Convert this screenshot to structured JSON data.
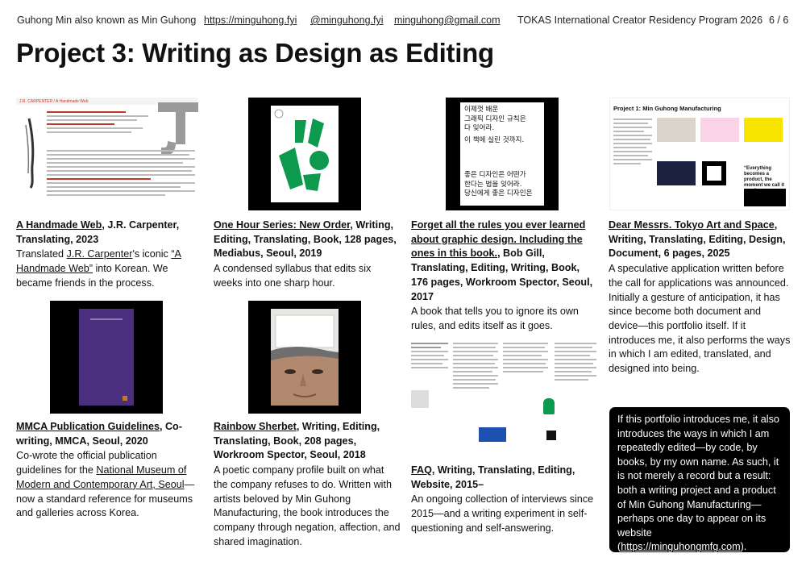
{
  "header": {
    "author": "Guhong Min also known as Min Guhong",
    "website": "https://minguhong.fyi",
    "handle": "@minguhong.fyi",
    "email": "minguhong@gmail.com",
    "program": "TOKAS International Creator Residency Program 2026",
    "page": "6 / 6"
  },
  "title": "Project 3: Writing as Design as Editing",
  "projects": [
    {
      "title": "A Handmade Web",
      "meta": ", J.R. Carpenter, Translating, 2023",
      "desc_a": "Translated ",
      "desc_link1": "J.R. Carpenter",
      "desc_b": "'s iconic ",
      "desc_link2": "“A Handmade Web”",
      "desc_c": " into Korean. We became friends in the process.",
      "thumb_heading": "J.R. CARPENTER / A Handmade Web"
    },
    {
      "title": "One Hour Series: New Order",
      "meta": ", Writing, Editing, Translating, Book, 128 pages, Mediabus, Seoul, 2019",
      "desc": "A condensed syllabus that edits six weeks into one sharp hour."
    },
    {
      "title": "Forget all the rules you ever learned about graphic design. Including the ones in this book.",
      "meta": ", Bob Gill, Translating, Editing, Writing, Book, 176 pages, Workroom Spector, Seoul, 2017",
      "desc": "A book that tells you to ignore its own rules, and edits itself as it goes.",
      "cover_text_top": [
        "이제껏 배운",
        "그래픽 디자인 규칙은",
        "다 잊어라.",
        "이 책에 실린 것까지."
      ],
      "cover_text_bottom": [
        "좋은 디자인은 어떤가",
        "한다는 법을 잊어라.",
        "당신에게 좋은 디자인은"
      ]
    },
    {
      "title": "Dear Messrs. Tokyo Art and Space",
      "meta": ", Writing, Translating, Editing, Design, Document, 6 pages, 2025",
      "desc": "A speculative application written before the call for applications was announced. Initially a gesture of anticipation, it has since become both document and device—this portfolio itself. If it introduces me, it also performs the ways in which I am edited, translated, and designed into being.",
      "thumb_heading": "Project 1: Min Guhong Manufacturing",
      "thumb_quote": "“Everything becomes a product, the moment we call it one.”"
    },
    {
      "title": "MMCA Publication Guidelines",
      "meta": ", Co-writing, MMCA, Seoul, 2020",
      "desc_a": "Co-wrote the official publication guidelines for the ",
      "desc_link": "National Museum of Modern and Contemporary Art, Seoul",
      "desc_b": "—now a standard reference for museums and galleries across Korea."
    },
    {
      "title": "Rainbow Sherbet",
      "meta": ", Writing, Editing, Translating, Book, 208 pages, Workroom Spector, Seoul, 2018",
      "desc": "A poetic company profile built on what the company refuses to do. Written with artists beloved by Min Guhong Manufacturing, the book introduces the company through negation, affection, and shared imagination."
    },
    {
      "title": "FAQ",
      "meta": ", Writing, Translating, Editing, Website, 2015–",
      "desc": "An ongoing collection of interviews since 2015—and a writing experiment in self-questioning and self-answering."
    }
  ],
  "statement": {
    "text_a": "If this portfolio introduces me, it also introduces the ways in which I am repeatedly edited—by code, by books, by my own name. As such, it is not merely a record but a result: both a writing project and a product of Min Guhong Manufacturing—perhaps one day to appear on its website (",
    "link": "https://minguhongmfg.com",
    "text_b": ")."
  },
  "colors": {
    "green": "#0d9a4e",
    "purple": "#4b2f7f",
    "orange": "#c47a1a",
    "red": "#c0392b"
  }
}
